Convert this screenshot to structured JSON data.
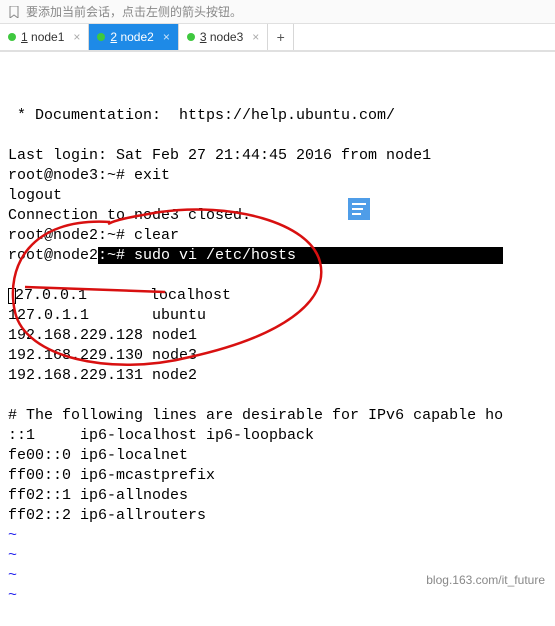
{
  "info_bar": {
    "text": "要添加当前会话，点击左侧的箭头按钮。"
  },
  "tabs": {
    "items": [
      {
        "num": "1",
        "label": "node1",
        "active": false
      },
      {
        "num": "2",
        "label": "node2",
        "active": true
      },
      {
        "num": "3",
        "label": "node3",
        "active": false
      }
    ],
    "add": "+"
  },
  "terminal": {
    "doc_line": " * Documentation:  https://help.ubuntu.com/",
    "last_login": "Last login: Sat Feb 27 21:44:45 2016 from node1",
    "l1": "root@node3:~# exit",
    "l2": "logout",
    "l3": "Connection to node3 closed.",
    "l4": "root@node2:~# clear",
    "l5a": "root@node2",
    "l5b": ":~# sudo vi /etc/hosts",
    "l5pad": "                       ",
    "hosts": [
      "27.0.0.1       localhost",
      "127.0.1.1       ubuntu",
      "192.168.229.128 node1",
      "192.168.229.130 node3",
      "192.168.229.131 node2"
    ],
    "v6_comment": "# The following lines are desirable for IPv6 capable ho",
    "v6": [
      "::1     ip6-localhost ip6-loopback",
      "fe00::0 ip6-localnet",
      "ff00::0 ip6-mcastprefix",
      "ff02::1 ip6-allnodes",
      "ff02::2 ip6-allrouters"
    ],
    "tilde": "~"
  },
  "watermark": "blog.163.com/it_future"
}
